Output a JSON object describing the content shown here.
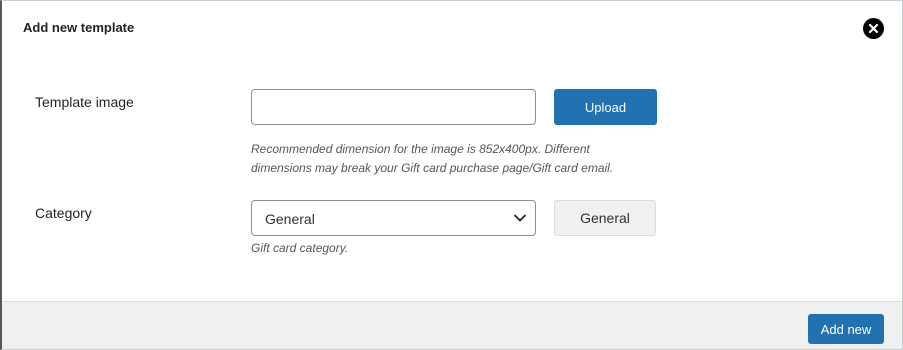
{
  "modal": {
    "title": "Add new template",
    "close_icon": "close-icon"
  },
  "form": {
    "template_image": {
      "label": "Template image",
      "value": "",
      "upload_label": "Upload",
      "description_line1": "Recommended dimension for the image is 852x400px. Different",
      "description_line2": "dimensions may break your Gift card purchase page/Gift card email."
    },
    "category": {
      "label": "Category",
      "selected": "General",
      "readonly_value": "General",
      "description": "Gift card category."
    }
  },
  "footer": {
    "add_new_label": "Add new"
  },
  "colors": {
    "primary": "#2271b1",
    "footer_bg": "#f0f0f1"
  }
}
